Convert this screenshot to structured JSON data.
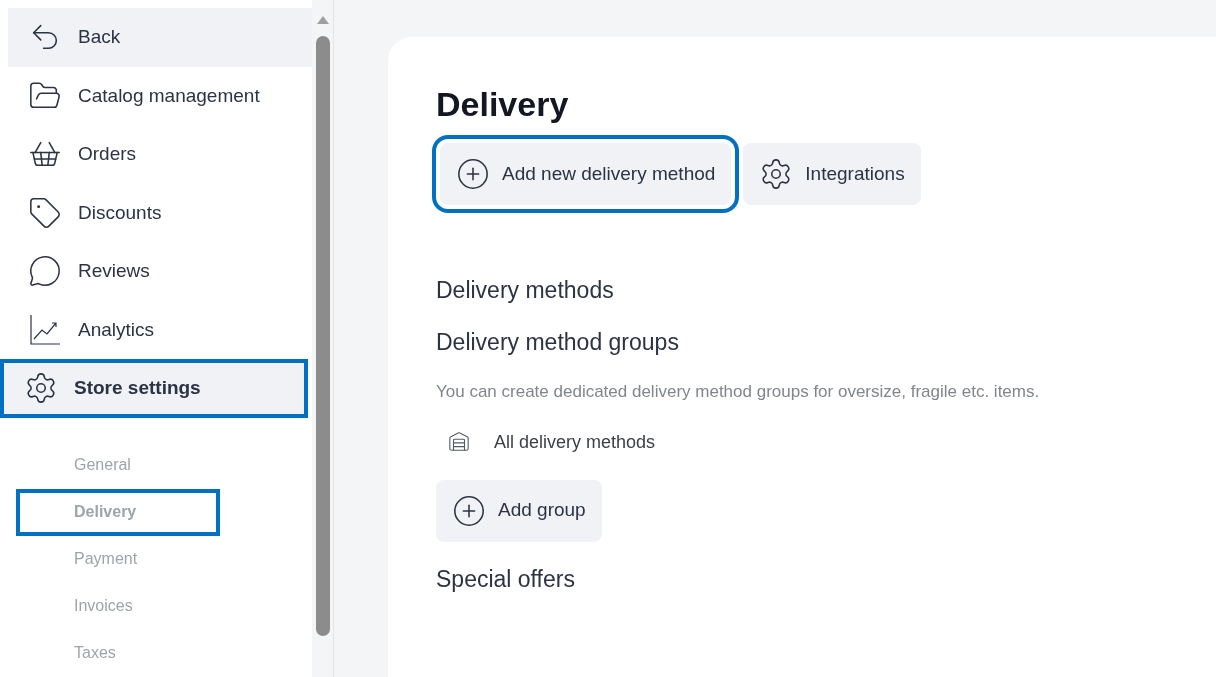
{
  "sidebar": {
    "items": [
      {
        "label": "Back",
        "kind": "back",
        "selected": false,
        "highlighted": false
      },
      {
        "label": "Catalog management",
        "kind": "folder",
        "selected": false,
        "highlighted": false
      },
      {
        "label": "Orders",
        "kind": "basket",
        "selected": false,
        "highlighted": false
      },
      {
        "label": "Discounts",
        "kind": "tag",
        "selected": false,
        "highlighted": false
      },
      {
        "label": "Reviews",
        "kind": "review",
        "selected": false,
        "highlighted": false
      },
      {
        "label": "Analytics",
        "kind": "chart",
        "selected": false,
        "highlighted": false
      },
      {
        "label": "Store settings",
        "kind": "gear",
        "selected": true,
        "highlighted": true
      }
    ],
    "sub_items": [
      {
        "label": "General",
        "selected": false,
        "highlighted": false
      },
      {
        "label": "Delivery",
        "selected": true,
        "highlighted": true
      },
      {
        "label": "Payment",
        "selected": false,
        "highlighted": false
      },
      {
        "label": "Invoices",
        "selected": false,
        "highlighted": false
      },
      {
        "label": "Taxes",
        "selected": false,
        "highlighted": false
      }
    ]
  },
  "page": {
    "title": "Delivery",
    "actions": [
      {
        "label": "Add new delivery method",
        "kind": "plus",
        "highlighted": true
      },
      {
        "label": "Integrations",
        "kind": "gear",
        "highlighted": false
      }
    ],
    "sections": [
      {
        "heading": "Delivery methods"
      },
      {
        "heading": "Delivery method groups",
        "description": "You can create dedicated delivery method groups for oversize, fragile etc. items.",
        "groups": [
          "All delivery methods"
        ],
        "button": "Add group"
      },
      {
        "heading": "Special offers"
      }
    ]
  }
}
